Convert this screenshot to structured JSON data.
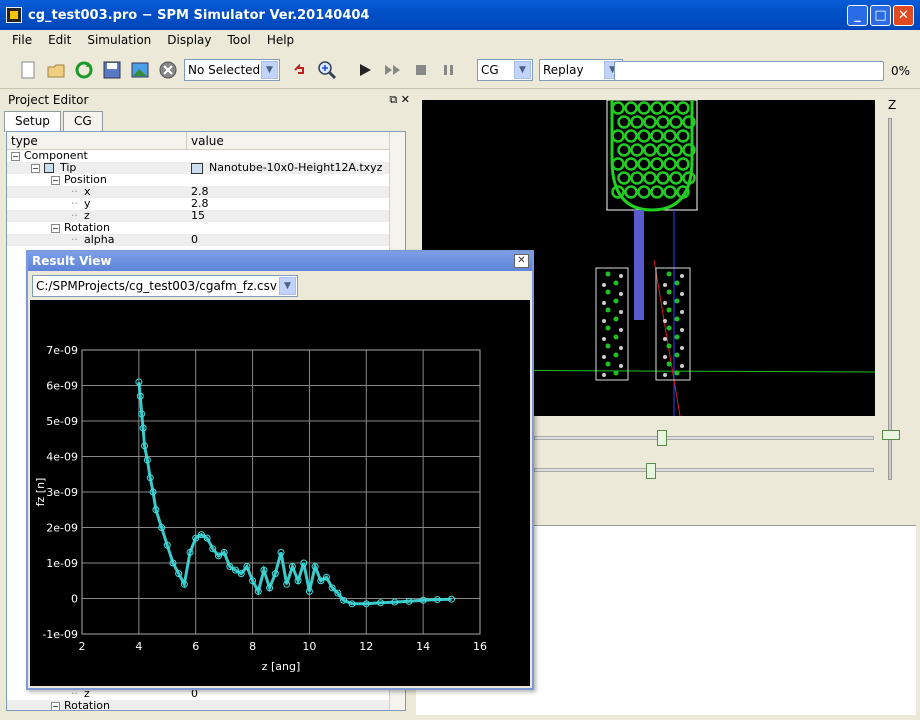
{
  "window": {
    "title": "cg_test003.pro − SPM Simulator Ver.20140404"
  },
  "menu": [
    "File",
    "Edit",
    "Simulation",
    "Display",
    "Tool",
    "Help"
  ],
  "toolbar": {
    "selection_value": "No Selected",
    "mode_value": "CG",
    "replay_value": "Replay",
    "progress_text": "0%",
    "progress": 0
  },
  "project_editor": {
    "title": "Project Editor",
    "tabs": [
      "Setup",
      "CG"
    ],
    "columns": [
      "type",
      "value"
    ],
    "rows": [
      {
        "type": "Component",
        "value": "",
        "indent": 0,
        "toggle": "−"
      },
      {
        "type": "Tip",
        "value": "Nanotube-10x0-Height12A.txyz",
        "indent": 1,
        "toggle": "−",
        "icon": true
      },
      {
        "type": "Position",
        "value": "",
        "indent": 2,
        "toggle": "−"
      },
      {
        "type": "x",
        "value": "2.8",
        "indent": 3
      },
      {
        "type": "y",
        "value": "2.8",
        "indent": 3
      },
      {
        "type": "z",
        "value": "15",
        "indent": 3
      },
      {
        "type": "Rotation",
        "value": "",
        "indent": 2,
        "toggle": "−"
      },
      {
        "type": "alpha",
        "value": "0",
        "indent": 3
      }
    ],
    "bottom_rows": [
      {
        "type": "z",
        "value": "0",
        "indent": 3
      },
      {
        "type": "Rotation",
        "value": "",
        "indent": 2,
        "toggle": "−"
      }
    ]
  },
  "viewport": {
    "axis_label": "Z"
  },
  "result_view": {
    "title": "Result View",
    "file_path": "C:/SPMProjects/cg_test003/cgafm_fz.csv"
  },
  "chart_data": {
    "type": "scatter",
    "xlabel": "z [ang]",
    "ylabel": "fz [n]",
    "xlim": [
      2,
      16
    ],
    "ylim": [
      -1e-09,
      7e-09
    ],
    "x_ticks": [
      "2",
      "4",
      "6",
      "8",
      "10",
      "12",
      "14",
      "16"
    ],
    "y_ticks": [
      "-1e-09",
      "0",
      "1e-09",
      "2e-09",
      "3e-09",
      "4e-09",
      "5e-09",
      "6e-09",
      "7e-09"
    ],
    "grid": true,
    "marker_color": "#40e0e0",
    "series": [
      {
        "x": [
          4.0,
          4.05,
          4.1,
          4.15,
          4.2,
          4.3,
          4.4,
          4.5,
          4.6,
          4.8,
          5.0,
          5.2,
          5.4,
          5.6,
          5.8,
          6.0,
          6.2,
          6.4,
          6.6,
          6.8,
          7.0,
          7.2,
          7.4,
          7.6,
          7.8,
          8.0,
          8.2,
          8.4,
          8.6,
          8.8,
          9.0,
          9.2,
          9.4,
          9.6,
          9.8,
          10.0,
          10.2,
          10.4,
          10.6,
          10.8,
          11.0,
          11.2,
          11.5,
          12.0,
          12.5,
          13.0,
          13.5,
          14.0,
          14.5,
          15.0
        ],
        "y": [
          6.1e-09,
          5.7e-09,
          5.2e-09,
          4.8e-09,
          4.3e-09,
          3.9e-09,
          3.4e-09,
          3e-09,
          2.5e-09,
          2e-09,
          1.5e-09,
          1e-09,
          7e-10,
          4e-10,
          1.3e-09,
          1.7e-09,
          1.8e-09,
          1.7e-09,
          1.4e-09,
          1.2e-09,
          1.3e-09,
          9e-10,
          8e-10,
          7e-10,
          9e-10,
          5e-10,
          2e-10,
          8e-10,
          3e-10,
          7e-10,
          1.3e-09,
          4e-10,
          9e-10,
          5e-10,
          1e-09,
          2e-10,
          9e-10,
          5e-10,
          6e-10,
          3e-10,
          1.5e-10,
          -5e-11,
          -1.5e-10,
          -1.5e-10,
          -1.2e-10,
          -1e-10,
          -8e-11,
          -5e-11,
          -3e-11,
          -2e-11
        ]
      }
    ]
  }
}
